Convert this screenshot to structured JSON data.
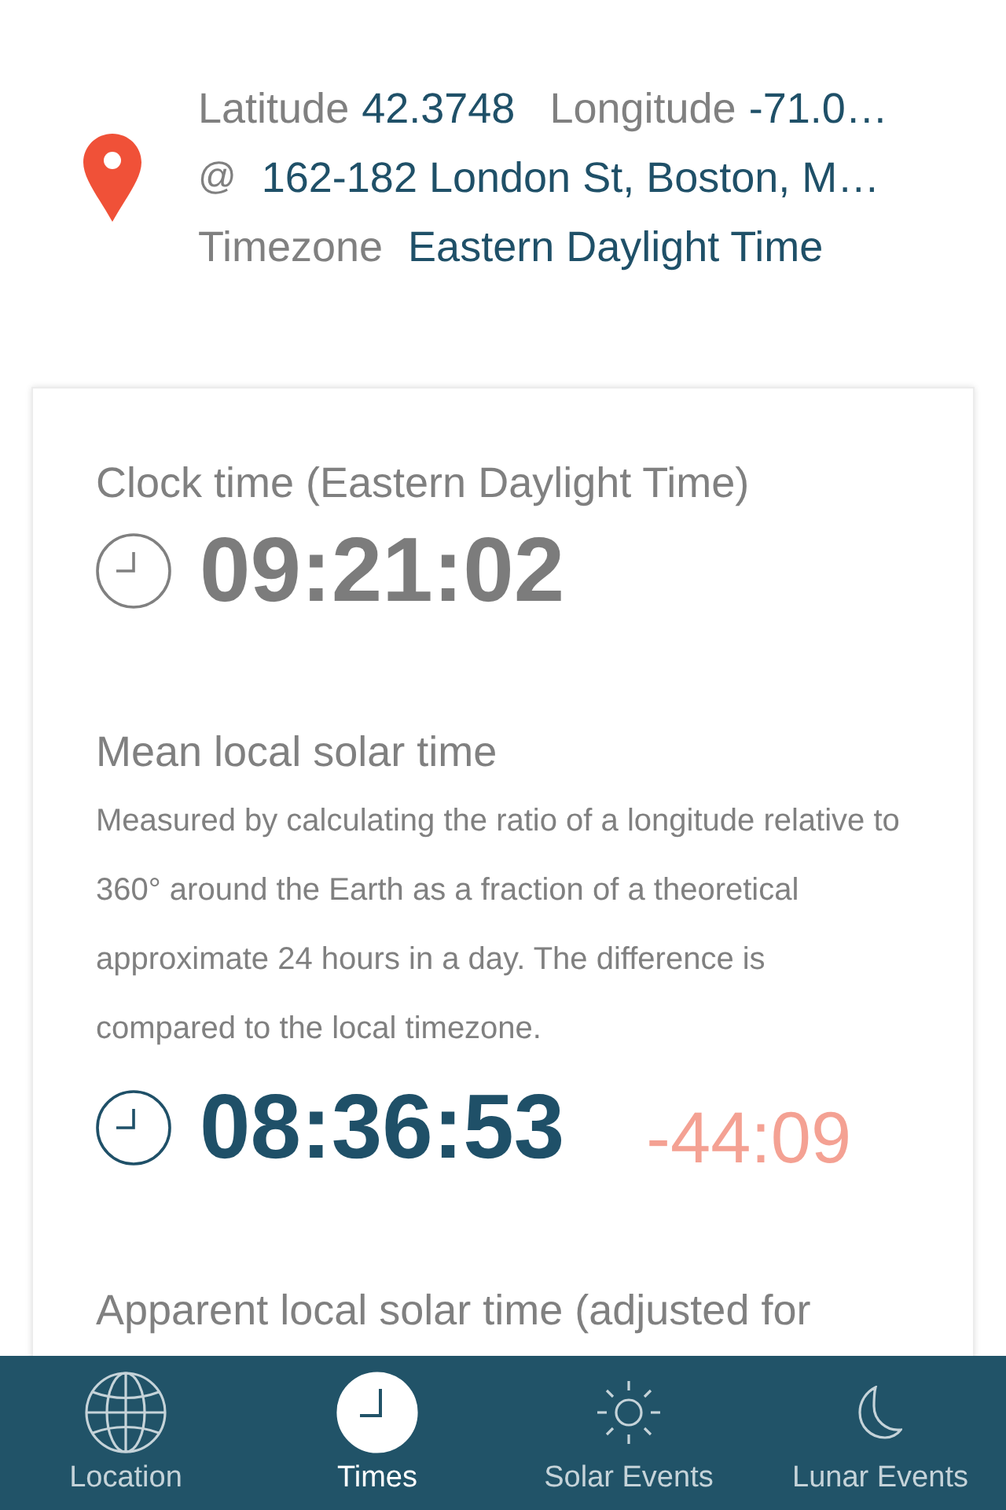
{
  "location": {
    "latitude_label": "Latitude",
    "latitude": "42.3748",
    "longitude_label": "Longitude",
    "longitude": "-71.0…",
    "address_prefix": "@",
    "address": "162-182 London St, Boston, M…",
    "timezone_label": "Timezone",
    "timezone": "Eastern Daylight Time"
  },
  "sections": [
    {
      "kind": "clock",
      "title": "Clock time (Eastern Daylight Time)",
      "time": "09:21:02"
    },
    {
      "kind": "solar",
      "title": "Mean local solar time",
      "description": "Measured by calculating the ratio of a longitude relative to 360° around the Earth as a fraction of a theoretical approximate 24 hours in a day. The difference is compared to the local timezone.",
      "time": "08:36:53",
      "difference": "-44:09"
    },
    {
      "kind": "heading",
      "title": "Apparent local solar time (adjusted for"
    }
  ],
  "tabs": [
    {
      "label": "Location",
      "selected": false
    },
    {
      "label": "Times",
      "selected": true
    },
    {
      "label": "Solar Events",
      "selected": false
    },
    {
      "label": "Lunar Events",
      "selected": false
    }
  ]
}
